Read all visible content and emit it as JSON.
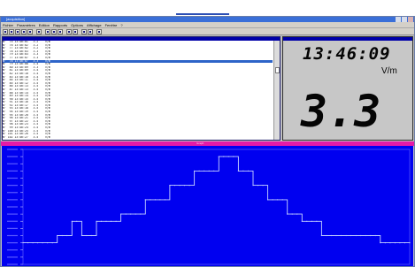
{
  "window": {
    "title": "[acquisition]",
    "menu": [
      "Fichier",
      "Paramètres",
      "Edition",
      "Rapports",
      "Options",
      "Affichage",
      "Fenêtre",
      "?"
    ]
  },
  "log_rows": [
    "N°  75 13:46:01   3.2    V/m",
    "N°  76 13:46:02   3.2    V/m",
    "N°  77 13:46:02   3.2    V/m",
    "N°  78 13:46:03   3.3    V/m",
    "N°  79 13:46:03   3.3    V/m",
    "N°  77 13:46:07   3.3    V/m",
    "N°  78 13:46:07   3.3    V/m",
    "N°  79 13:46:08   3.4    V/m",
    "N°  80 13:46:09   3.3    V/m",
    "N°  81 13:46:09   3.4    V/m",
    "N°  82 13:46:10   3.4    V/m",
    "N°  83 13:46:10   3.4    V/m",
    "N°  84 13:46:11   3.4    V/m",
    "N°  85 13:46:12   3.5    V/m",
    "N°  86 13:46:13   3.5    V/m",
    "N°  87 13:46:13   3.5    V/m",
    "N°  88 13:46:14   3.5    V/m",
    "N°  89 13:46:14   3.5    V/m",
    "N°  90 13:46:15   3.5    V/m",
    "N°  91 13:46:16   3.5    V/m",
    "N°  92 13:46:17   3.5    V/m",
    "N°  93 13:46:18   3.5    V/m",
    "N°  94 13:46:19   3.5    V/m",
    "N°  95 13:46:20   3.5    V/m",
    "N°  96 13:46:21   3.5    V/m",
    "N°  97 13:46:22   3.5    V/m",
    "N°  98 13:46:23   3.5    V/m",
    "N°  99 13:46:24   3.5    V/m",
    "N° 100 13:46:25   3.5    V/m",
    "N° 101 13:46:26   3.5    V/m",
    "N° 102 13:46:27   3.5    V/m"
  ],
  "selected_row_index": 6,
  "display": {
    "time": "13:46:09",
    "value": "3.3",
    "unit": "V/m"
  },
  "splitter_label": "Graph",
  "chart_data": {
    "type": "line",
    "series": [
      {
        "values": [
          2.9,
          2.9,
          2.9,
          2.9,
          2.9,
          2.9,
          2.9,
          3.0,
          3.0,
          3.0,
          3.2,
          3.2,
          3.0,
          3.0,
          3.0,
          3.2,
          3.2,
          3.2,
          3.2,
          3.2,
          3.3,
          3.3,
          3.3,
          3.3,
          3.3,
          3.5,
          3.5,
          3.5,
          3.5,
          3.5,
          3.7,
          3.7,
          3.7,
          3.7,
          3.7,
          3.9,
          3.9,
          3.9,
          3.9,
          3.9,
          4.1,
          4.1,
          4.1,
          4.1,
          3.9,
          3.9,
          3.9,
          3.7,
          3.7,
          3.7,
          3.5,
          3.5,
          3.5,
          3.5,
          3.3,
          3.3,
          3.3,
          3.2,
          3.2,
          3.2,
          3.2,
          3.0,
          3.0,
          3.0,
          3.0,
          3.0,
          3.0,
          3.0,
          3.0,
          3.0,
          3.0,
          3.0,
          3.0,
          2.9,
          2.9,
          2.9,
          2.9,
          2.9,
          2.9,
          2.9
        ]
      }
    ]
  }
}
